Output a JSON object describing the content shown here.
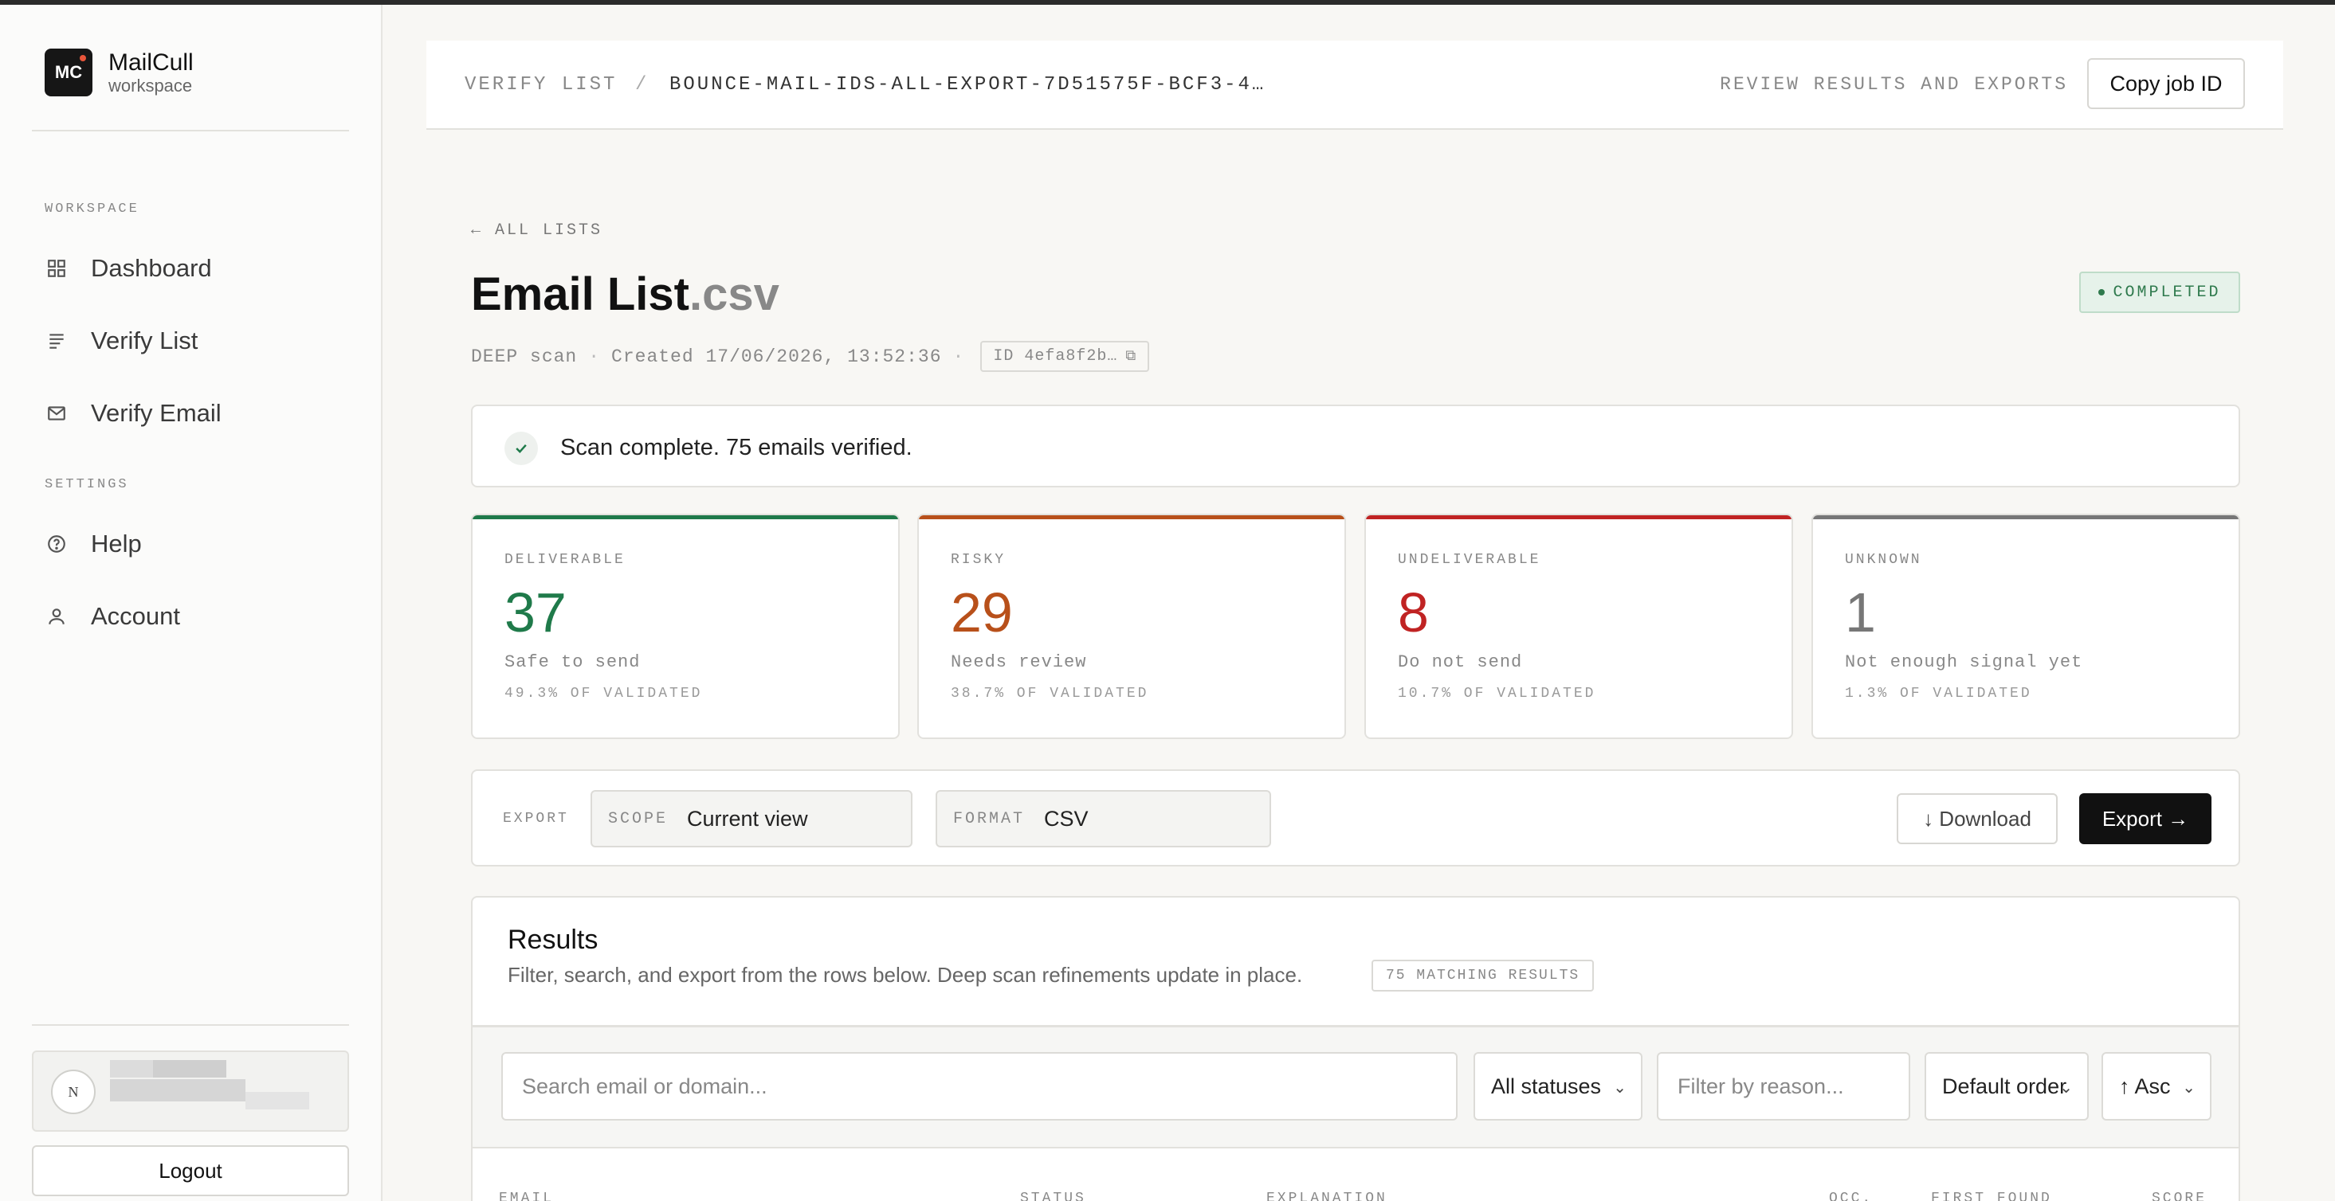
{
  "brand": {
    "logo_text": "MC",
    "name": "MailCull",
    "sub": "workspace"
  },
  "sidebar": {
    "section_workspace": "WORKSPACE",
    "section_settings": "SETTINGS",
    "items": [
      {
        "label": "Dashboard",
        "icon": "grid-icon"
      },
      {
        "label": "Verify List",
        "icon": "list-icon"
      },
      {
        "label": "Verify Email",
        "icon": "mail-icon"
      },
      {
        "label": "Help",
        "icon": "help-circle-icon"
      },
      {
        "label": "Account",
        "icon": "user-icon"
      }
    ],
    "user": {
      "avatar_initial": "N"
    },
    "logout_label": "Logout"
  },
  "topbar": {
    "crumb_parent": "VERIFY LIST",
    "crumb_sep": "/",
    "crumb_current": "BOUNCE-MAIL-IDS-ALL-EXPORT-7D51575F-BCF3-4…",
    "hint": "REVIEW RESULTS AND EXPORTS",
    "copy_label": "Copy job ID"
  },
  "page": {
    "back_label": "← ALL LISTS",
    "title_name": "Email List",
    "title_ext": ".csv",
    "status": "COMPLETED",
    "scan_type": "DEEP scan",
    "created": "Created 17/06/2026, 13:52:36",
    "id_chip": "ID 4efa8f2b…",
    "banner_text": "Scan complete. 75 emails verified."
  },
  "stats": [
    {
      "label": "DELIVERABLE",
      "value": "37",
      "desc": "Safe to send",
      "pct": "49.3% OF VALIDATED",
      "color": "#1f7a4a"
    },
    {
      "label": "RISKY",
      "value": "29",
      "desc": "Needs review",
      "pct": "38.7% OF VALIDATED",
      "color": "#b8501a"
    },
    {
      "label": "UNDELIVERABLE",
      "value": "8",
      "desc": "Do not send",
      "pct": "10.7% OF VALIDATED",
      "color": "#c02323"
    },
    {
      "label": "UNKNOWN",
      "value": "1",
      "desc": "Not enough signal yet",
      "pct": "1.3% OF VALIDATED",
      "color": "#777777"
    }
  ],
  "export": {
    "label": "EXPORT",
    "scope_key": "SCOPE",
    "scope_value": "Current view",
    "format_key": "FORMAT",
    "format_value": "CSV",
    "download_label": "↓ Download",
    "export_label": "Export →"
  },
  "results": {
    "title": "Results",
    "subtitle": "Filter, search, and export from the rows below. Deep scan refinements update in place.",
    "count_badge": "75 MATCHING RESULTS",
    "search_placeholder": "Search email or domain...",
    "status_filter": "All statuses",
    "reason_placeholder": "Filter by reason...",
    "order": "Default order",
    "direction": "↑ Asc",
    "columns": [
      "EMAIL",
      "STATUS",
      "EXPLANATION",
      "OCC.",
      "FIRST FOUND",
      "SCORE"
    ]
  }
}
